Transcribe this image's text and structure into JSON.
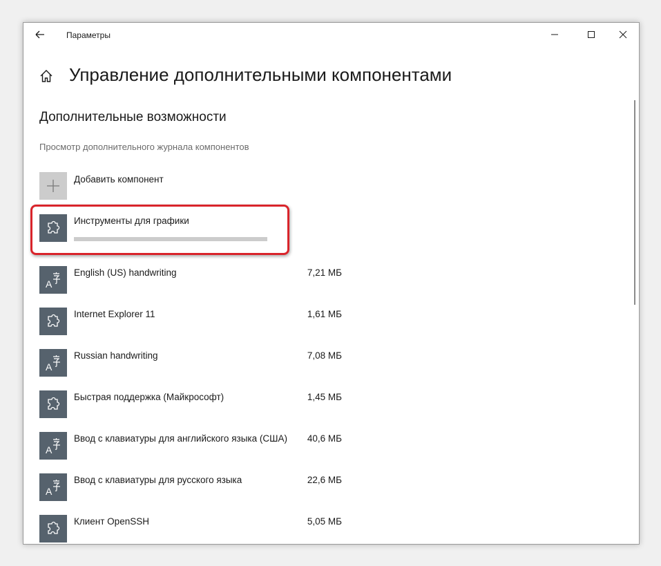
{
  "window": {
    "title": "Параметры"
  },
  "page": {
    "title": "Управление дополнительными компонентами"
  },
  "section": {
    "title": "Дополнительные возможности",
    "history_link": "Просмотр дополнительного журнала компонентов"
  },
  "add_feature": {
    "label": "Добавить компонент",
    "icon": "plus-icon"
  },
  "installing": {
    "label": "Инструменты для графики",
    "icon": "puzzle-icon",
    "progress": 0,
    "highlight_color": "#d9242b"
  },
  "features": [
    {
      "name": "English (US) handwriting",
      "size": "7,21 МБ",
      "icon": "language-icon"
    },
    {
      "name": "Internet Explorer 11",
      "size": "1,61 МБ",
      "icon": "puzzle-icon"
    },
    {
      "name": "Russian handwriting",
      "size": "7,08 МБ",
      "icon": "language-icon"
    },
    {
      "name": "Быстрая поддержка (Майкрософт)",
      "size": "1,45 МБ",
      "icon": "puzzle-icon"
    },
    {
      "name": "Ввод с клавиатуры для английского языка (США)",
      "size": "40,6 МБ",
      "icon": "language-icon"
    },
    {
      "name": "Ввод с клавиатуры для русского языка",
      "size": "22,6 МБ",
      "icon": "language-icon"
    },
    {
      "name": "Клиент OpenSSH",
      "size": "5,05 МБ",
      "icon": "puzzle-icon"
    }
  ],
  "colors": {
    "tile": "#56626d",
    "add_tile": "#cccccc",
    "accent": "#0078d7"
  }
}
